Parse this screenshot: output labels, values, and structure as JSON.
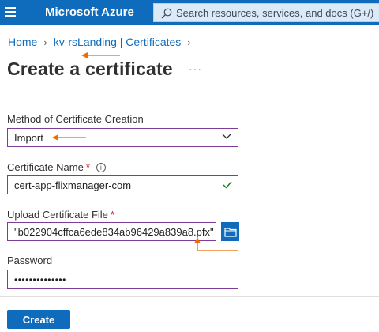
{
  "app": {
    "brand": "Microsoft Azure",
    "search_placeholder": "Search resources, services, and docs (G+/)"
  },
  "breadcrumb": [
    {
      "label": "Home"
    },
    {
      "label": "kv-rsLanding | Certificates"
    }
  ],
  "page": {
    "title": "Create a certificate",
    "more_label": "···"
  },
  "form": {
    "method": {
      "label": "Method of Certificate Creation",
      "value": "Import"
    },
    "name": {
      "label": "Certificate Name",
      "required_mark": "*",
      "info_icon": "i",
      "value": "cert-app-flixmanager-com"
    },
    "file": {
      "label": "Upload Certificate File",
      "required_mark": "*",
      "value": "\"b022904cffca6ede834ab96429a839a8.pfx\""
    },
    "password": {
      "label": "Password",
      "value": "••••••••••••••"
    }
  },
  "actions": {
    "create_label": "Create"
  },
  "icons": [
    "menu-icon",
    "search-icon",
    "chevron-right-icon",
    "more-icon",
    "chevron-down-icon",
    "info-icon",
    "checkmark-icon",
    "folder-icon"
  ],
  "colors": {
    "azure_blue": "#0f6cbd",
    "field_border": "#7d3c98",
    "annotation_orange": "#ef6c00",
    "valid_green": "#107c10",
    "required_red": "#c50f1f"
  }
}
